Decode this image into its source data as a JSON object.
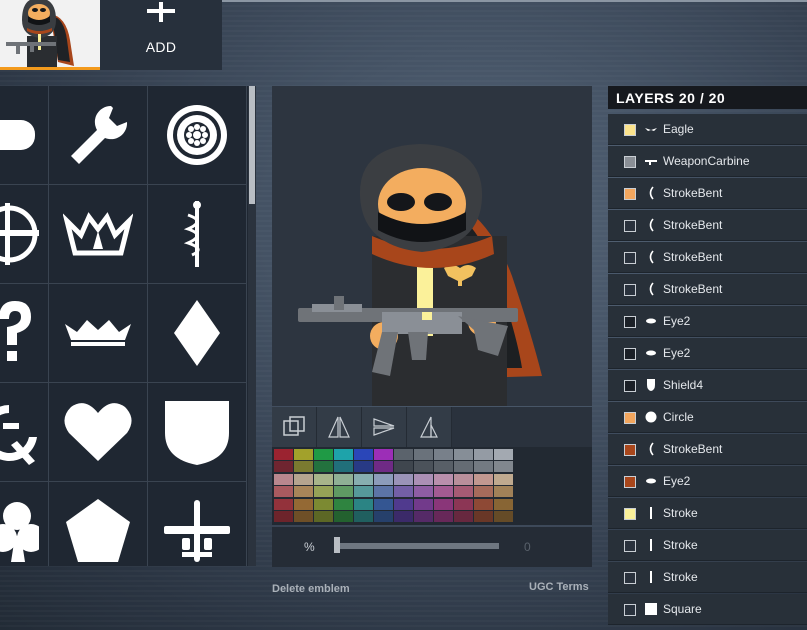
{
  "tabs": {
    "emblem_tab": "current emblem",
    "add_label": "ADD"
  },
  "shape_library": {
    "shapes": [
      "rounded-rect",
      "wrench",
      "gear-wheel",
      "crosshair",
      "crown",
      "caduceus",
      "question-mark",
      "crown-low",
      "diamond",
      "hammer-sickle",
      "heart",
      "shield",
      "club",
      "pentagon",
      "aircraft"
    ]
  },
  "tools": [
    "layer-order",
    "flip-horizontal",
    "flip-vertical",
    "mirror"
  ],
  "palette": {
    "rows": [
      [
        "#9b2330",
        "#a2a12b",
        "#1f9a45",
        "#1ea3aa",
        "#2a46b8",
        "#9c2eb7",
        "#5b636c",
        "#6a727b",
        "#78808a",
        "#868e97",
        "#949ba4",
        "#a3a9b1"
      ],
      [
        "#6f2530",
        "#7a7a30",
        "#23713e",
        "#216f7a",
        "#283a85",
        "#6f2a85",
        "#3f464e",
        "#4b525a",
        "#585f67",
        "#656c74",
        "#737a82",
        "#81878e"
      ],
      [
        "#b9878e",
        "#b5a48f",
        "#a7b48a",
        "#8fb095",
        "#87aeb0",
        "#8c9cba",
        "#9a93b8",
        "#ab8fb5",
        "#b98fac",
        "#b98f9b",
        "#c29890",
        "#bfa98f"
      ],
      [
        "#a85a5f",
        "#a88559",
        "#95a257",
        "#5f9a63",
        "#56999a",
        "#5c74a6",
        "#735fa6",
        "#8e5da3",
        "#a35b92",
        "#a55b74",
        "#a66b5b",
        "#a18158"
      ],
      [
        "#93323b",
        "#946934",
        "#7c8a32",
        "#2f8440",
        "#2b8484",
        "#345692",
        "#503a8e",
        "#723a8b",
        "#8a3679",
        "#8c3655",
        "#8e4935",
        "#886534"
      ],
      [
        "#6d242b",
        "#6e4f27",
        "#5c6725",
        "#23612f",
        "#205f5f",
        "#26406b",
        "#3b2a69",
        "#552a67",
        "#672859",
        "#67283f",
        "#693727",
        "#654b27"
      ]
    ]
  },
  "opacity": {
    "symbol": "%",
    "value": "0"
  },
  "footer": {
    "delete_label": "Delete emblem",
    "ugc_label": "UGC Terms"
  },
  "layers": {
    "title": "LAYERS 20 / 20",
    "items": [
      {
        "name": "Eagle",
        "color": "#fbe38c",
        "icon": "eagle-icon"
      },
      {
        "name": "WeaponCarbine",
        "color": "#8a8f96",
        "icon": "carbine-icon"
      },
      {
        "name": "StrokeBent",
        "color": "#f2a65e",
        "icon": "bent-stroke-icon"
      },
      {
        "name": "StrokeBent",
        "color": "#2a323d",
        "icon": "bent-stroke-icon"
      },
      {
        "name": "StrokeBent",
        "color": "#2a323d",
        "icon": "bent-stroke-icon"
      },
      {
        "name": "StrokeBent",
        "color": "#2a323d",
        "icon": "bent-stroke-icon"
      },
      {
        "name": "Eye2",
        "color": "#1b2027",
        "icon": "eye-icon"
      },
      {
        "name": "Eye2",
        "color": "#1b2027",
        "icon": "eye-icon"
      },
      {
        "name": "Shield4",
        "color": "#1b2027",
        "icon": "shield-icon"
      },
      {
        "name": "Circle",
        "color": "#f2a65e",
        "icon": "circle-icon"
      },
      {
        "name": "StrokeBent",
        "color": "#a8461b",
        "icon": "bent-stroke-icon"
      },
      {
        "name": "Eye2",
        "color": "#a8461b",
        "icon": "eye-icon"
      },
      {
        "name": "Stroke",
        "color": "#fbf19a",
        "icon": "stroke-icon"
      },
      {
        "name": "Stroke",
        "color": "#2a323d",
        "icon": "stroke-icon"
      },
      {
        "name": "Stroke",
        "color": "#2a323d",
        "icon": "stroke-icon"
      },
      {
        "name": "Square",
        "color": "#2a323d",
        "icon": "square-icon"
      }
    ]
  }
}
